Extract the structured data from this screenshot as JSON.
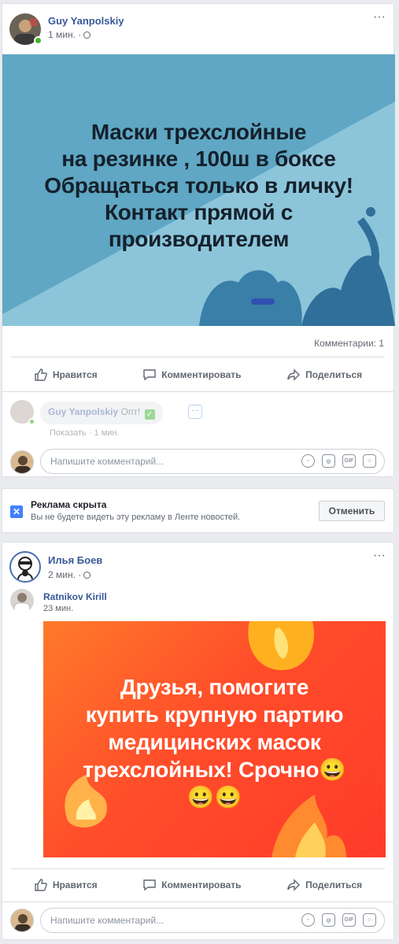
{
  "post1": {
    "author": "Guy Yanpolskiy",
    "time": "1 мин. ·",
    "more": "···",
    "banner_lines": [
      "Маски трехслойные",
      "на резинке , 100ш в боксе",
      "Обращаться только в личку!",
      "Контакт прямой с",
      "производителем"
    ],
    "comments_count": "Комментарии: 1",
    "actions": {
      "like": "Нравится",
      "comment": "Комментировать",
      "share": "Поделиться"
    },
    "reply": {
      "author": "Guy Yanpolskiy",
      "text": "Опт!",
      "links": "Показать · 1 мин."
    },
    "comment_placeholder": "Напишите комментарий..."
  },
  "ad_hidden": {
    "title": "Реклама скрыта",
    "subtitle": "Вы не будете видеть эту рекламу в Ленте новостей.",
    "undo": "Отменить"
  },
  "post2": {
    "author": "Илья Боев",
    "time": "2 мин. ·",
    "more": "···",
    "shared_author": "Ratnikov Kirill",
    "shared_time": "23 мин.",
    "banner_lines": [
      "Друзья, помогите",
      "купить крупную партию",
      "медицинских масок",
      "трехслойных! Срочно😀",
      "😀😀"
    ],
    "actions": {
      "like": "Нравится",
      "comment": "Комментировать",
      "share": "Поделиться"
    },
    "comment_placeholder": "Напишите комментарий..."
  },
  "colors": {
    "link": "#385898",
    "banner1": "#5fa7c4",
    "banner2": "#ff4d2a"
  }
}
